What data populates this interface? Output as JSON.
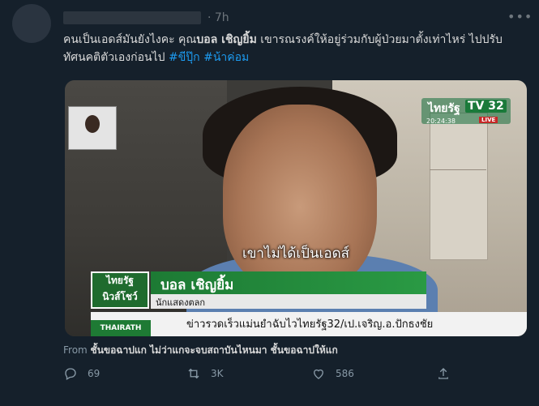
{
  "tweet": {
    "time": "· 7h",
    "text_parts": {
      "part1": "คนเป็นเอดส์มันยังไงคะ คุณ",
      "bold_name": "บอล เชิญยิ้ม",
      "part2": " เขารณรงค์ให้อยู่ร่วมกับผู้ป่วยมาตั้งเท่าไหร่ ไปปรับทัศนคติตัวเองก่อนไป ",
      "hashtag1": "#ขีปุ๊ก",
      "hashtag2": "#น้าค่อม"
    }
  },
  "video": {
    "channel_logo": "ไทยรัฐ",
    "channel_tv": "TV 32",
    "clock": "20:24:38",
    "live": "LIVE",
    "subtitle": "เขาไม่ได้เป็นเอดส์",
    "show_logo_line1": "ไทยรัฐ",
    "show_logo_line2": "นิวส์โชว์",
    "name": "บอล เชิญยิ้ม",
    "role": "นักแสดงตลก",
    "ticker_brand": "THAIRATH",
    "ticker": "ข่าวรวดเร็วแม่นยำฉับไวไทยรัฐ32/เป.เจริญ.อ.ปักธงชัย"
  },
  "from": {
    "prefix": "From ",
    "text": "ชั้นขอฉาปแก ไม่ว่าแกจะจบสถาบันไหนมา ชั้นขอฉาปให้แก"
  },
  "actions": {
    "reply_count": "69",
    "retweet_count": "3K",
    "like_count": "586"
  },
  "icons": [
    "more-icon",
    "reply-icon",
    "retweet-icon",
    "like-icon",
    "share-icon"
  ]
}
